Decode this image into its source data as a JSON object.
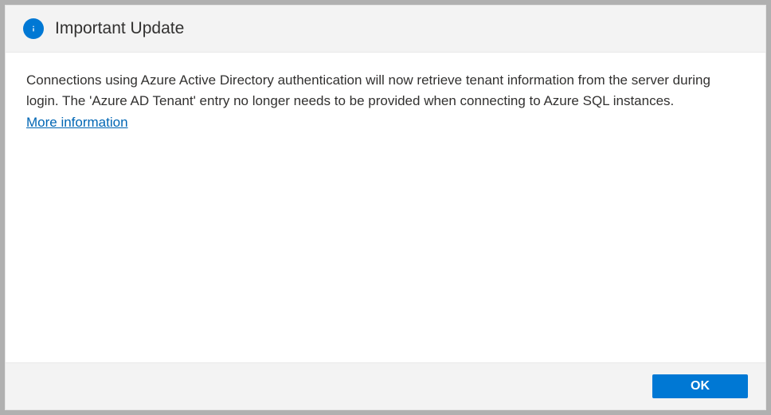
{
  "dialog": {
    "title": "Important Update",
    "body": "Connections using Azure Active Directory authentication will now retrieve tenant information from the server during login. The 'Azure AD Tenant' entry no longer needs to be provided when connecting to Azure SQL instances.",
    "link_label": "More information",
    "ok_label": "OK"
  }
}
